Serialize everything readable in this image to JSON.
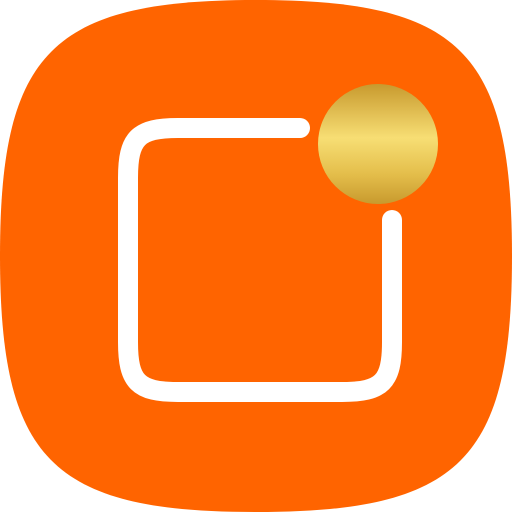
{
  "app_icon": {
    "icon": "notification-badge-icon",
    "colors": {
      "background": "#FF6400",
      "glyph": "#FFFFFF",
      "badge_light": "#F7DE74",
      "badge_mid": "#E4BE4B",
      "badge_dark": "#C89A2E"
    }
  }
}
